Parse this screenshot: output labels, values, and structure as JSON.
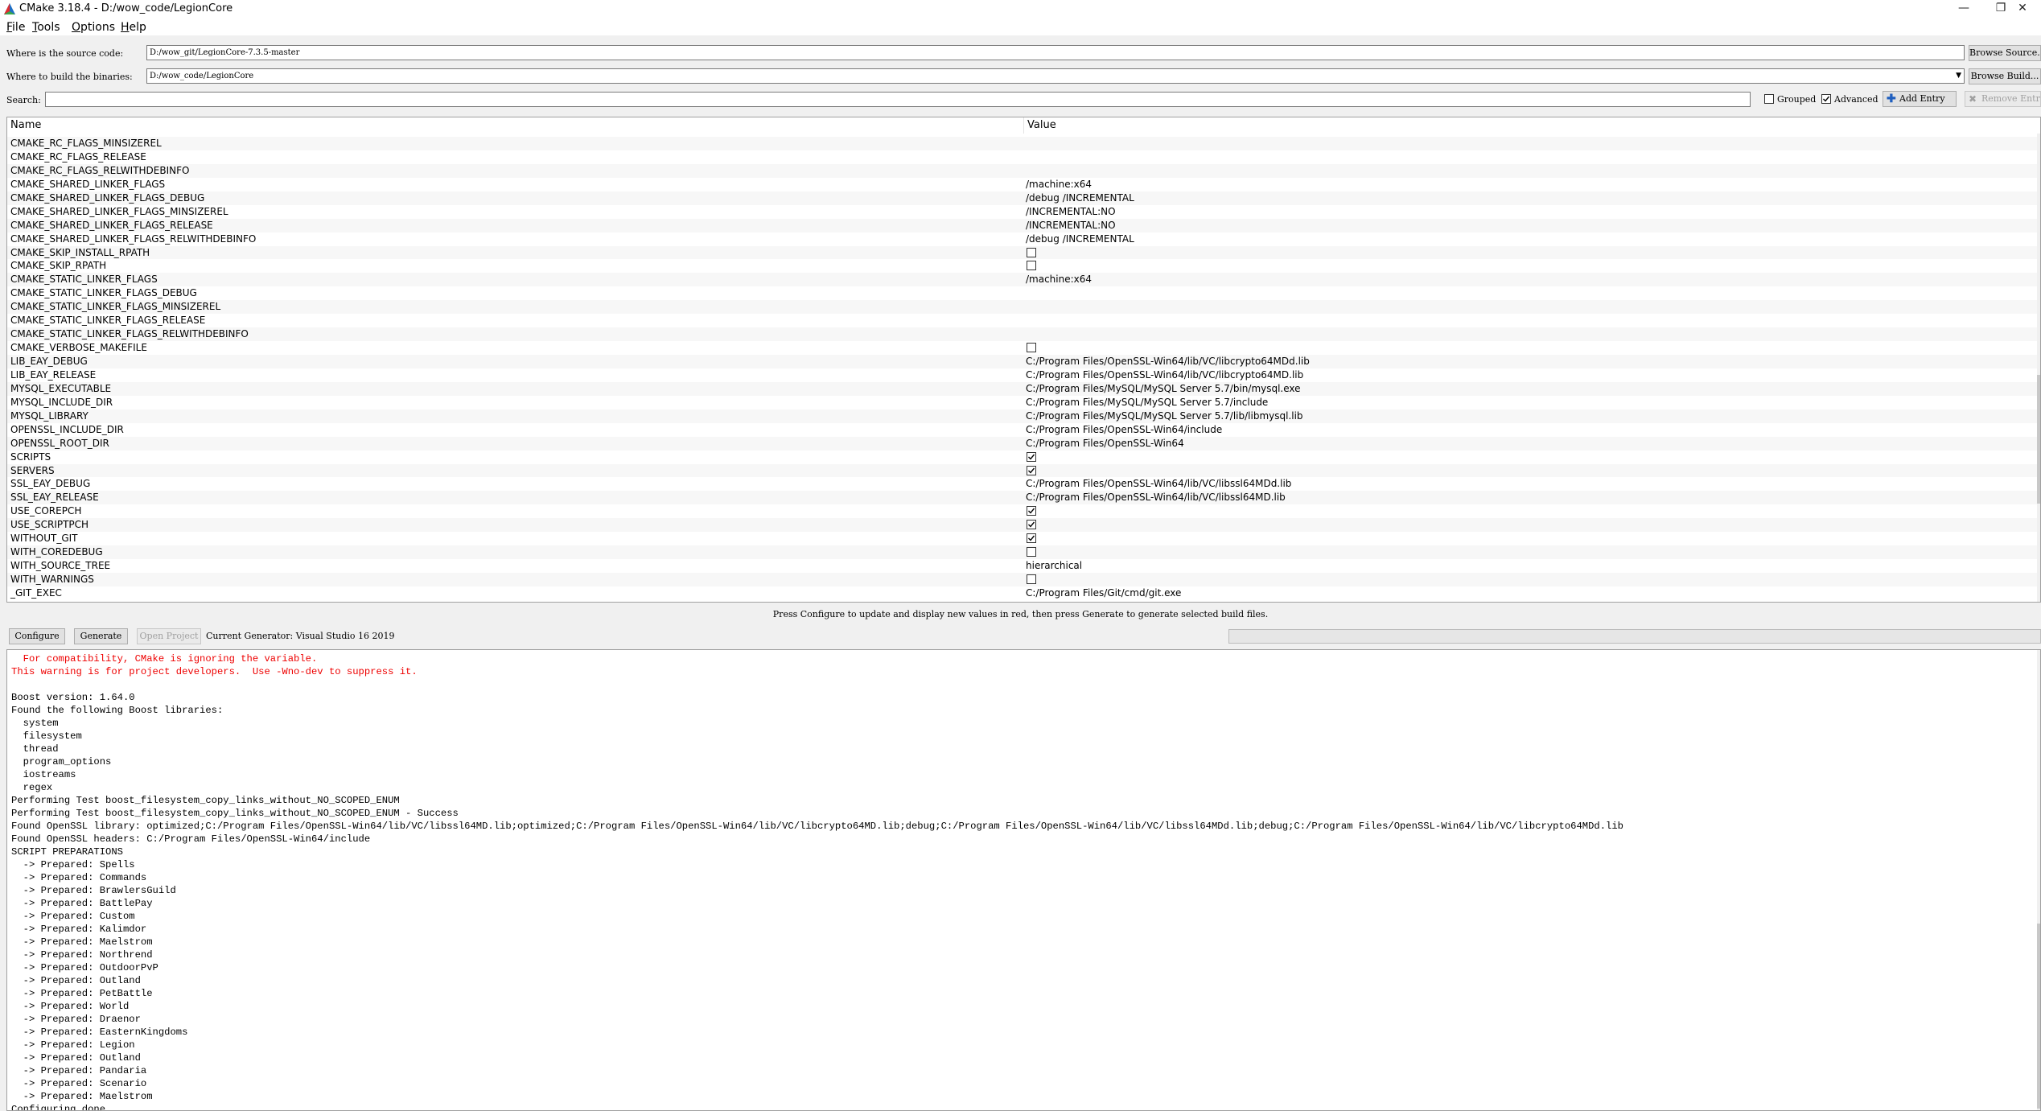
{
  "window": {
    "title": "CMake 3.18.4 - D:/wow_code/LegionCore",
    "controls": {
      "minimize": "—",
      "restore": "❐",
      "close": "✕"
    }
  },
  "menu": [
    {
      "label": "File",
      "mnemonic": "F",
      "rest": "ile"
    },
    {
      "label": "Tools",
      "mnemonic": "T",
      "rest": "ools"
    },
    {
      "label": "Options",
      "mnemonic": "O",
      "rest": "ptions"
    },
    {
      "label": "Help",
      "mnemonic": "H",
      "rest": "elp"
    }
  ],
  "source": {
    "label": "Where is the source code:",
    "value": "D:/wow_git/LegionCore-7.3.5-master",
    "browse": "Browse Source..."
  },
  "build": {
    "label": "Where to build the binaries:",
    "value": "D:/wow_code/LegionCore",
    "browse": "Browse Build..."
  },
  "search": {
    "label": "Search:",
    "value": "",
    "grouped": "Grouped",
    "grouped_checked": false,
    "advanced": "Advanced",
    "advanced_checked": true,
    "add_entry": "Add Entry",
    "remove_entry": "Remove Entry"
  },
  "table": {
    "headers": {
      "name": "Name",
      "value": "Value"
    },
    "rows": [
      {
        "name": "CMAKE_RC_FLAGS_MINSIZEREL",
        "type": "text",
        "value": ""
      },
      {
        "name": "CMAKE_RC_FLAGS_RELEASE",
        "type": "text",
        "value": ""
      },
      {
        "name": "CMAKE_RC_FLAGS_RELWITHDEBINFO",
        "type": "text",
        "value": ""
      },
      {
        "name": "CMAKE_SHARED_LINKER_FLAGS",
        "type": "text",
        "value": "/machine:x64"
      },
      {
        "name": "CMAKE_SHARED_LINKER_FLAGS_DEBUG",
        "type": "text",
        "value": "/debug /INCREMENTAL"
      },
      {
        "name": "CMAKE_SHARED_LINKER_FLAGS_MINSIZEREL",
        "type": "text",
        "value": "/INCREMENTAL:NO"
      },
      {
        "name": "CMAKE_SHARED_LINKER_FLAGS_RELEASE",
        "type": "text",
        "value": "/INCREMENTAL:NO"
      },
      {
        "name": "CMAKE_SHARED_LINKER_FLAGS_RELWITHDEBINFO",
        "type": "text",
        "value": "/debug /INCREMENTAL"
      },
      {
        "name": "CMAKE_SKIP_INSTALL_RPATH",
        "type": "bool",
        "checked": false
      },
      {
        "name": "CMAKE_SKIP_RPATH",
        "type": "bool",
        "checked": false
      },
      {
        "name": "CMAKE_STATIC_LINKER_FLAGS",
        "type": "text",
        "value": "/machine:x64"
      },
      {
        "name": "CMAKE_STATIC_LINKER_FLAGS_DEBUG",
        "type": "text",
        "value": ""
      },
      {
        "name": "CMAKE_STATIC_LINKER_FLAGS_MINSIZEREL",
        "type": "text",
        "value": ""
      },
      {
        "name": "CMAKE_STATIC_LINKER_FLAGS_RELEASE",
        "type": "text",
        "value": ""
      },
      {
        "name": "CMAKE_STATIC_LINKER_FLAGS_RELWITHDEBINFO",
        "type": "text",
        "value": ""
      },
      {
        "name": "CMAKE_VERBOSE_MAKEFILE",
        "type": "bool",
        "checked": false
      },
      {
        "name": "LIB_EAY_DEBUG",
        "type": "text",
        "value": "C:/Program Files/OpenSSL-Win64/lib/VC/libcrypto64MDd.lib"
      },
      {
        "name": "LIB_EAY_RELEASE",
        "type": "text",
        "value": "C:/Program Files/OpenSSL-Win64/lib/VC/libcrypto64MD.lib"
      },
      {
        "name": "MYSQL_EXECUTABLE",
        "type": "text",
        "value": "C:/Program Files/MySQL/MySQL Server 5.7/bin/mysql.exe"
      },
      {
        "name": "MYSQL_INCLUDE_DIR",
        "type": "text",
        "value": "C:/Program Files/MySQL/MySQL Server 5.7/include"
      },
      {
        "name": "MYSQL_LIBRARY",
        "type": "text",
        "value": "C:/Program Files/MySQL/MySQL Server 5.7/lib/libmysql.lib"
      },
      {
        "name": "OPENSSL_INCLUDE_DIR",
        "type": "text",
        "value": "C:/Program Files/OpenSSL-Win64/include"
      },
      {
        "name": "OPENSSL_ROOT_DIR",
        "type": "text",
        "value": "C:/Program Files/OpenSSL-Win64"
      },
      {
        "name": "SCRIPTS",
        "type": "bool",
        "checked": true
      },
      {
        "name": "SERVERS",
        "type": "bool",
        "checked": true
      },
      {
        "name": "SSL_EAY_DEBUG",
        "type": "text",
        "value": "C:/Program Files/OpenSSL-Win64/lib/VC/libssl64MDd.lib"
      },
      {
        "name": "SSL_EAY_RELEASE",
        "type": "text",
        "value": "C:/Program Files/OpenSSL-Win64/lib/VC/libssl64MD.lib"
      },
      {
        "name": "USE_COREPCH",
        "type": "bool",
        "checked": true
      },
      {
        "name": "USE_SCRIPTPCH",
        "type": "bool",
        "checked": true
      },
      {
        "name": "WITHOUT_GIT",
        "type": "bool",
        "checked": true
      },
      {
        "name": "WITH_COREDEBUG",
        "type": "bool",
        "checked": false
      },
      {
        "name": "WITH_SOURCE_TREE",
        "type": "text",
        "value": "hierarchical"
      },
      {
        "name": "WITH_WARNINGS",
        "type": "bool",
        "checked": false
      },
      {
        "name": "_GIT_EXEC",
        "type": "text",
        "value": "C:/Program Files/Git/cmd/git.exe"
      }
    ]
  },
  "hint": "Press Configure to update and display new values in red, then press Generate to generate selected build files.",
  "actions": {
    "configure": "Configure",
    "generate": "Generate",
    "open_project": "Open Project",
    "generator": "Current Generator: Visual Studio 16 2019"
  },
  "output": [
    {
      "text": "  For compatibility, CMake is ignoring the variable.",
      "warn": true
    },
    {
      "text": "This warning is for project developers.  Use -Wno-dev to suppress it.",
      "warn": true
    },
    {
      "text": "",
      "warn": false
    },
    {
      "text": "Boost version: 1.64.0",
      "warn": false
    },
    {
      "text": "Found the following Boost libraries:",
      "warn": false
    },
    {
      "text": "  system",
      "warn": false
    },
    {
      "text": "  filesystem",
      "warn": false
    },
    {
      "text": "  thread",
      "warn": false
    },
    {
      "text": "  program_options",
      "warn": false
    },
    {
      "text": "  iostreams",
      "warn": false
    },
    {
      "text": "  regex",
      "warn": false
    },
    {
      "text": "Performing Test boost_filesystem_copy_links_without_NO_SCOPED_ENUM",
      "warn": false
    },
    {
      "text": "Performing Test boost_filesystem_copy_links_without_NO_SCOPED_ENUM - Success",
      "warn": false
    },
    {
      "text": "Found OpenSSL library: optimized;C:/Program Files/OpenSSL-Win64/lib/VC/libssl64MD.lib;optimized;C:/Program Files/OpenSSL-Win64/lib/VC/libcrypto64MD.lib;debug;C:/Program Files/OpenSSL-Win64/lib/VC/libssl64MDd.lib;debug;C:/Program Files/OpenSSL-Win64/lib/VC/libcrypto64MDd.lib",
      "warn": false
    },
    {
      "text": "Found OpenSSL headers: C:/Program Files/OpenSSL-Win64/include",
      "warn": false
    },
    {
      "text": "SCRIPT PREPARATIONS",
      "warn": false
    },
    {
      "text": "  -> Prepared: Spells",
      "warn": false
    },
    {
      "text": "  -> Prepared: Commands",
      "warn": false
    },
    {
      "text": "  -> Prepared: BrawlersGuild",
      "warn": false
    },
    {
      "text": "  -> Prepared: BattlePay",
      "warn": false
    },
    {
      "text": "  -> Prepared: Custom",
      "warn": false
    },
    {
      "text": "  -> Prepared: Kalimdor",
      "warn": false
    },
    {
      "text": "  -> Prepared: Maelstrom",
      "warn": false
    },
    {
      "text": "  -> Prepared: Northrend",
      "warn": false
    },
    {
      "text": "  -> Prepared: OutdoorPvP",
      "warn": false
    },
    {
      "text": "  -> Prepared: Outland",
      "warn": false
    },
    {
      "text": "  -> Prepared: PetBattle",
      "warn": false
    },
    {
      "text": "  -> Prepared: World",
      "warn": false
    },
    {
      "text": "  -> Prepared: Draenor",
      "warn": false
    },
    {
      "text": "  -> Prepared: EasternKingdoms",
      "warn": false
    },
    {
      "text": "  -> Prepared: Legion",
      "warn": false
    },
    {
      "text": "  -> Prepared: Outland",
      "warn": false
    },
    {
      "text": "  -> Prepared: Pandaria",
      "warn": false
    },
    {
      "text": "  -> Prepared: Scenario",
      "warn": false
    },
    {
      "text": "  -> Prepared: Maelstrom",
      "warn": false
    },
    {
      "text": "Configuring done",
      "warn": false
    }
  ]
}
